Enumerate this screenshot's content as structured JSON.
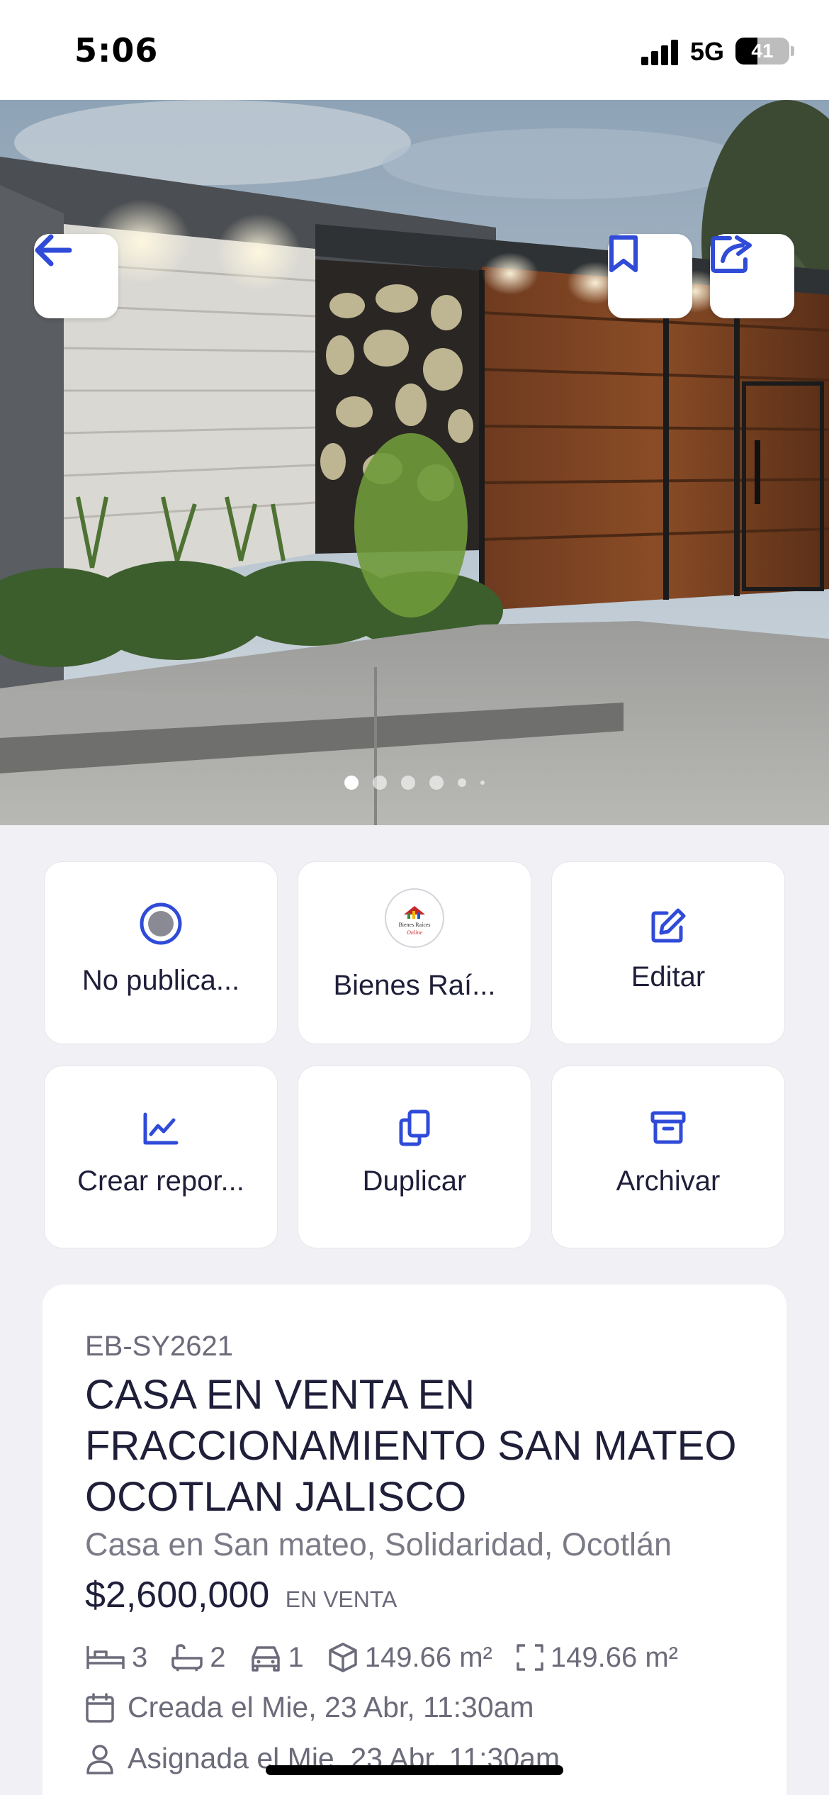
{
  "status_bar": {
    "time": "5:06",
    "network": "5G",
    "battery": "41"
  },
  "hero": {
    "image_count": 6,
    "active_index": 0
  },
  "actions": [
    {
      "label": "No publica...",
      "icon": "radio-icon"
    },
    {
      "label": "Bienes Raí...",
      "icon": "agency-logo"
    },
    {
      "label": "Editar",
      "icon": "edit-icon"
    },
    {
      "label": "Crear repor...",
      "icon": "chart-icon"
    },
    {
      "label": "Duplicar",
      "icon": "copy-icon"
    },
    {
      "label": "Archivar",
      "icon": "archive-icon"
    }
  ],
  "logo_text": {
    "line1": "Bienes Raíces",
    "line2": "Online"
  },
  "property": {
    "code": "EB-SY2621",
    "title": "CASA EN VENTA EN FRACCIONAMIENTO SAN MATEO OCOTLAN JALISCO",
    "subtitle": "Casa en San mateo, Solidaridad, Ocotlán",
    "price": "$2,600,000",
    "status": "EN VENTA",
    "bedrooms": "3",
    "bathrooms": "2",
    "parking": "1",
    "built_area": "149.66 m²",
    "lot_area": "149.66 m²",
    "created": "Creada el Mie, 23 Abr, 11:30am",
    "assigned": "Asignada el Mie, 23 Abr, 11:30am"
  },
  "colors": {
    "accent": "#2f4bd8",
    "text": "#1f1f3a",
    "muted": "#6b6b7a",
    "background": "#f1f1f5"
  }
}
